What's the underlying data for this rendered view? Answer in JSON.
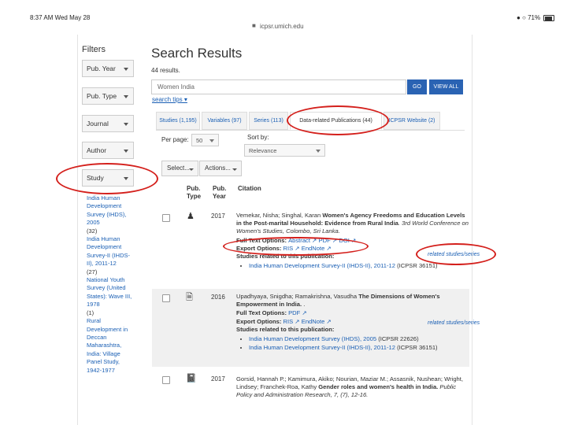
{
  "status_bar": {
    "time": "8:37 AM  Wed May 28",
    "url": "icpsr.umich.edu",
    "right": "● ○ 71%"
  },
  "filters": {
    "title": "Filters",
    "buttons": [
      "Pub. Year",
      "Pub. Type",
      "Journal",
      "Author",
      "Study"
    ],
    "studies": [
      {
        "label": "India Human Development Survey (IHDS), 2005",
        "count": "(32)"
      },
      {
        "label": "India Human Development Survey-II (IHDS-II), 2011-12",
        "count": "(27)"
      },
      {
        "label": "National Youth Survey (United States): Wave III, 1978",
        "count": "(1)"
      },
      {
        "label": "Rural Development in Deccan Maharashtra, India: Village Panel Study, 1942-1977",
        "count": ""
      }
    ]
  },
  "main": {
    "title": "Search Results",
    "count": "44 results.",
    "search_value": "Women India",
    "go_label": "GO",
    "view_all_label": "VIEW ALL",
    "search_tips": "search tips ▾",
    "tabs": [
      "Studies (1,195)",
      "Variables (97)",
      "Series (113)",
      "Data-related Publications (44)",
      "ICPSR Website (2)"
    ],
    "per_page_label": "Per page:",
    "per_page_value": "50",
    "sort_label": "Sort by:",
    "sort_value": "Relevance",
    "select_label": "Select...",
    "actions_label": "Actions...",
    "headers": {
      "pub_type": "Pub. Type",
      "pub_year": "Pub. Year",
      "citation": "Citation"
    }
  },
  "results": [
    {
      "year": "2017",
      "authors": "Vemekar, Nisha; Singhal, Karan ",
      "title": "Women's Agency Freedoms and Education Levels in the Post-marital Household: Evidence from Rural India",
      "pub": ". 3rd World Conference on Women's Studies, Colombo, Sri Lanka.",
      "full_text_label": "Full Text Options: ",
      "full_text_links": [
        "Abstract ↗",
        "PDF ↗",
        "DOI ↗"
      ],
      "export_label": "Export Options: ",
      "export_links": [
        "RIS ↗",
        "EndNote ↗"
      ],
      "related_label": "related studies/series",
      "studies_label": "Studies related to this publication:",
      "studies": [
        {
          "link": "India Human Development Survey-II (IHDS-II), 2011-12",
          "suffix": " (ICPSR 36151)"
        }
      ]
    },
    {
      "year": "2016",
      "authors": "Upadhyaya, Snigdha; Ramakrishna, Vasudha ",
      "title": "The Dimensions of Women's Empowerment in India.",
      "pub": " .",
      "full_text_label": "Full Text Options: ",
      "full_text_links": [
        "PDF ↗"
      ],
      "export_label": "Export Options: ",
      "export_links": [
        "RIS ↗",
        "EndNote ↗"
      ],
      "related_label": "related studies/series",
      "studies_label": "Studies related to this publication:",
      "studies": [
        {
          "link": "India Human Development Survey (IHDS), 2005",
          "suffix": " (ICPSR 22626)"
        },
        {
          "link": "India Human Development Survey-II (IHDS-II), 2011-12",
          "suffix": " (ICPSR 36151)"
        }
      ]
    },
    {
      "year": "2017",
      "authors": "Gorsid, Hannah P.; Kamimura, Akiko; Nourian, Maziar M.; Assasnik, Nushean; Wright, Lindsey; Franchek-Roa, Kathy ",
      "title": "Gender roles and women's health in India.",
      "pub": " Public Policy and Administration Research, 7, (7), 12-16."
    }
  ],
  "colors": {
    "link": "#1a5fb4",
    "primary_button": "#2a63b3",
    "annotation": "#d4201c"
  }
}
